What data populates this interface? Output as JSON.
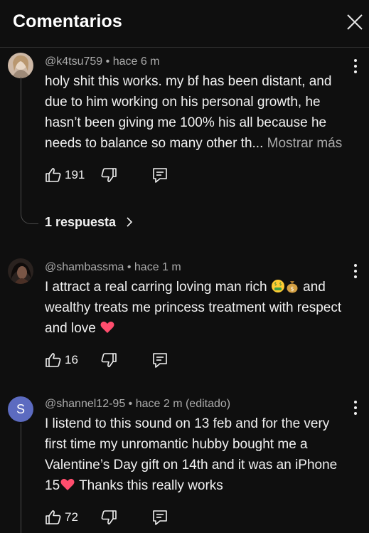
{
  "header": {
    "title": "Comentarios",
    "close_icon": "close-icon"
  },
  "comments": [
    {
      "author": "@k4tsu759",
      "time": "hace 6 m",
      "text": "holy shit this works. my bf has been distant, and due to him working on his personal growth, he hasn’t been giving me 100% his all because he needs to balance so many other th...",
      "more": "Mostrar más",
      "likes": "191",
      "replies": "1 respuesta"
    },
    {
      "author": "@shambassma",
      "time": "hace 1 m",
      "text_before": "I attract a real carring loving man rich",
      "text_after": "and wealthy treats me princess treatment with respect and love",
      "emojis": [
        "money-mouth-face-emoji",
        "money-bag-emoji",
        "red-heart-emoji"
      ],
      "likes": "16"
    },
    {
      "author": "@shannel12-95",
      "time": "hace 2 m (editado)",
      "avatar_letter": "S",
      "text_before": "I listend to this sound on 13 feb and for the very first time my unromantic hubby bought me a Valentine’s Day gift on 14th and it was an iPhone 15",
      "text_after": "Thanks this really works",
      "emojis": [
        "red-heart-emoji"
      ],
      "likes": "72"
    }
  ],
  "colors": {
    "background": "#0f0f0f",
    "text": "#f1f1f1",
    "secondary_text": "#aaaaaa",
    "avatar_s": "#5c6bc0"
  }
}
